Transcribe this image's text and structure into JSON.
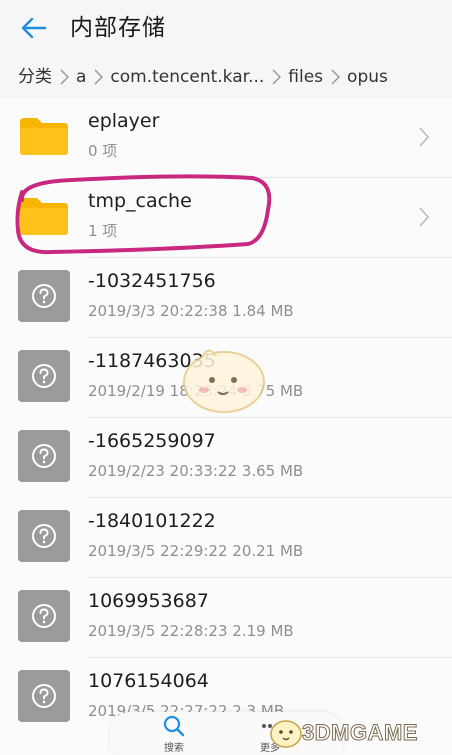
{
  "header": {
    "title": "内部存储"
  },
  "breadcrumb": {
    "items": [
      "分类",
      "a",
      "com.tencent.kar...",
      "files",
      "opus"
    ]
  },
  "rows": [
    {
      "type": "folder",
      "name": "eplayer",
      "meta": "0 项"
    },
    {
      "type": "folder",
      "name": "tmp_cache",
      "meta": "1 项"
    },
    {
      "type": "file",
      "name": "-1032451756",
      "meta": "2019/3/3 20:22:38 1.84 MB"
    },
    {
      "type": "file",
      "name": "-1187463035",
      "meta": "2019/2/19 18:23:24 3.75 MB"
    },
    {
      "type": "file",
      "name": "-1665259097",
      "meta": "2019/2/23 20:33:22 3.65 MB"
    },
    {
      "type": "file",
      "name": "-1840101222",
      "meta": "2019/3/5 22:29:22 20.21 MB"
    },
    {
      "type": "file",
      "name": "1069953687",
      "meta": "2019/3/5 22:28:23 2.19 MB"
    },
    {
      "type": "file",
      "name": "1076154064",
      "meta": "2019/3/5 22:27:22 2.3 MB"
    }
  ],
  "bottombar": {
    "search_label": "搜索",
    "more_label": "更多"
  },
  "watermark": {
    "text": "3DMGAME"
  },
  "colors": {
    "accent": "#1f8ee0",
    "folder": "#f7b500",
    "annotation": "#c8297e",
    "file_icon": "#9b9b9b"
  }
}
